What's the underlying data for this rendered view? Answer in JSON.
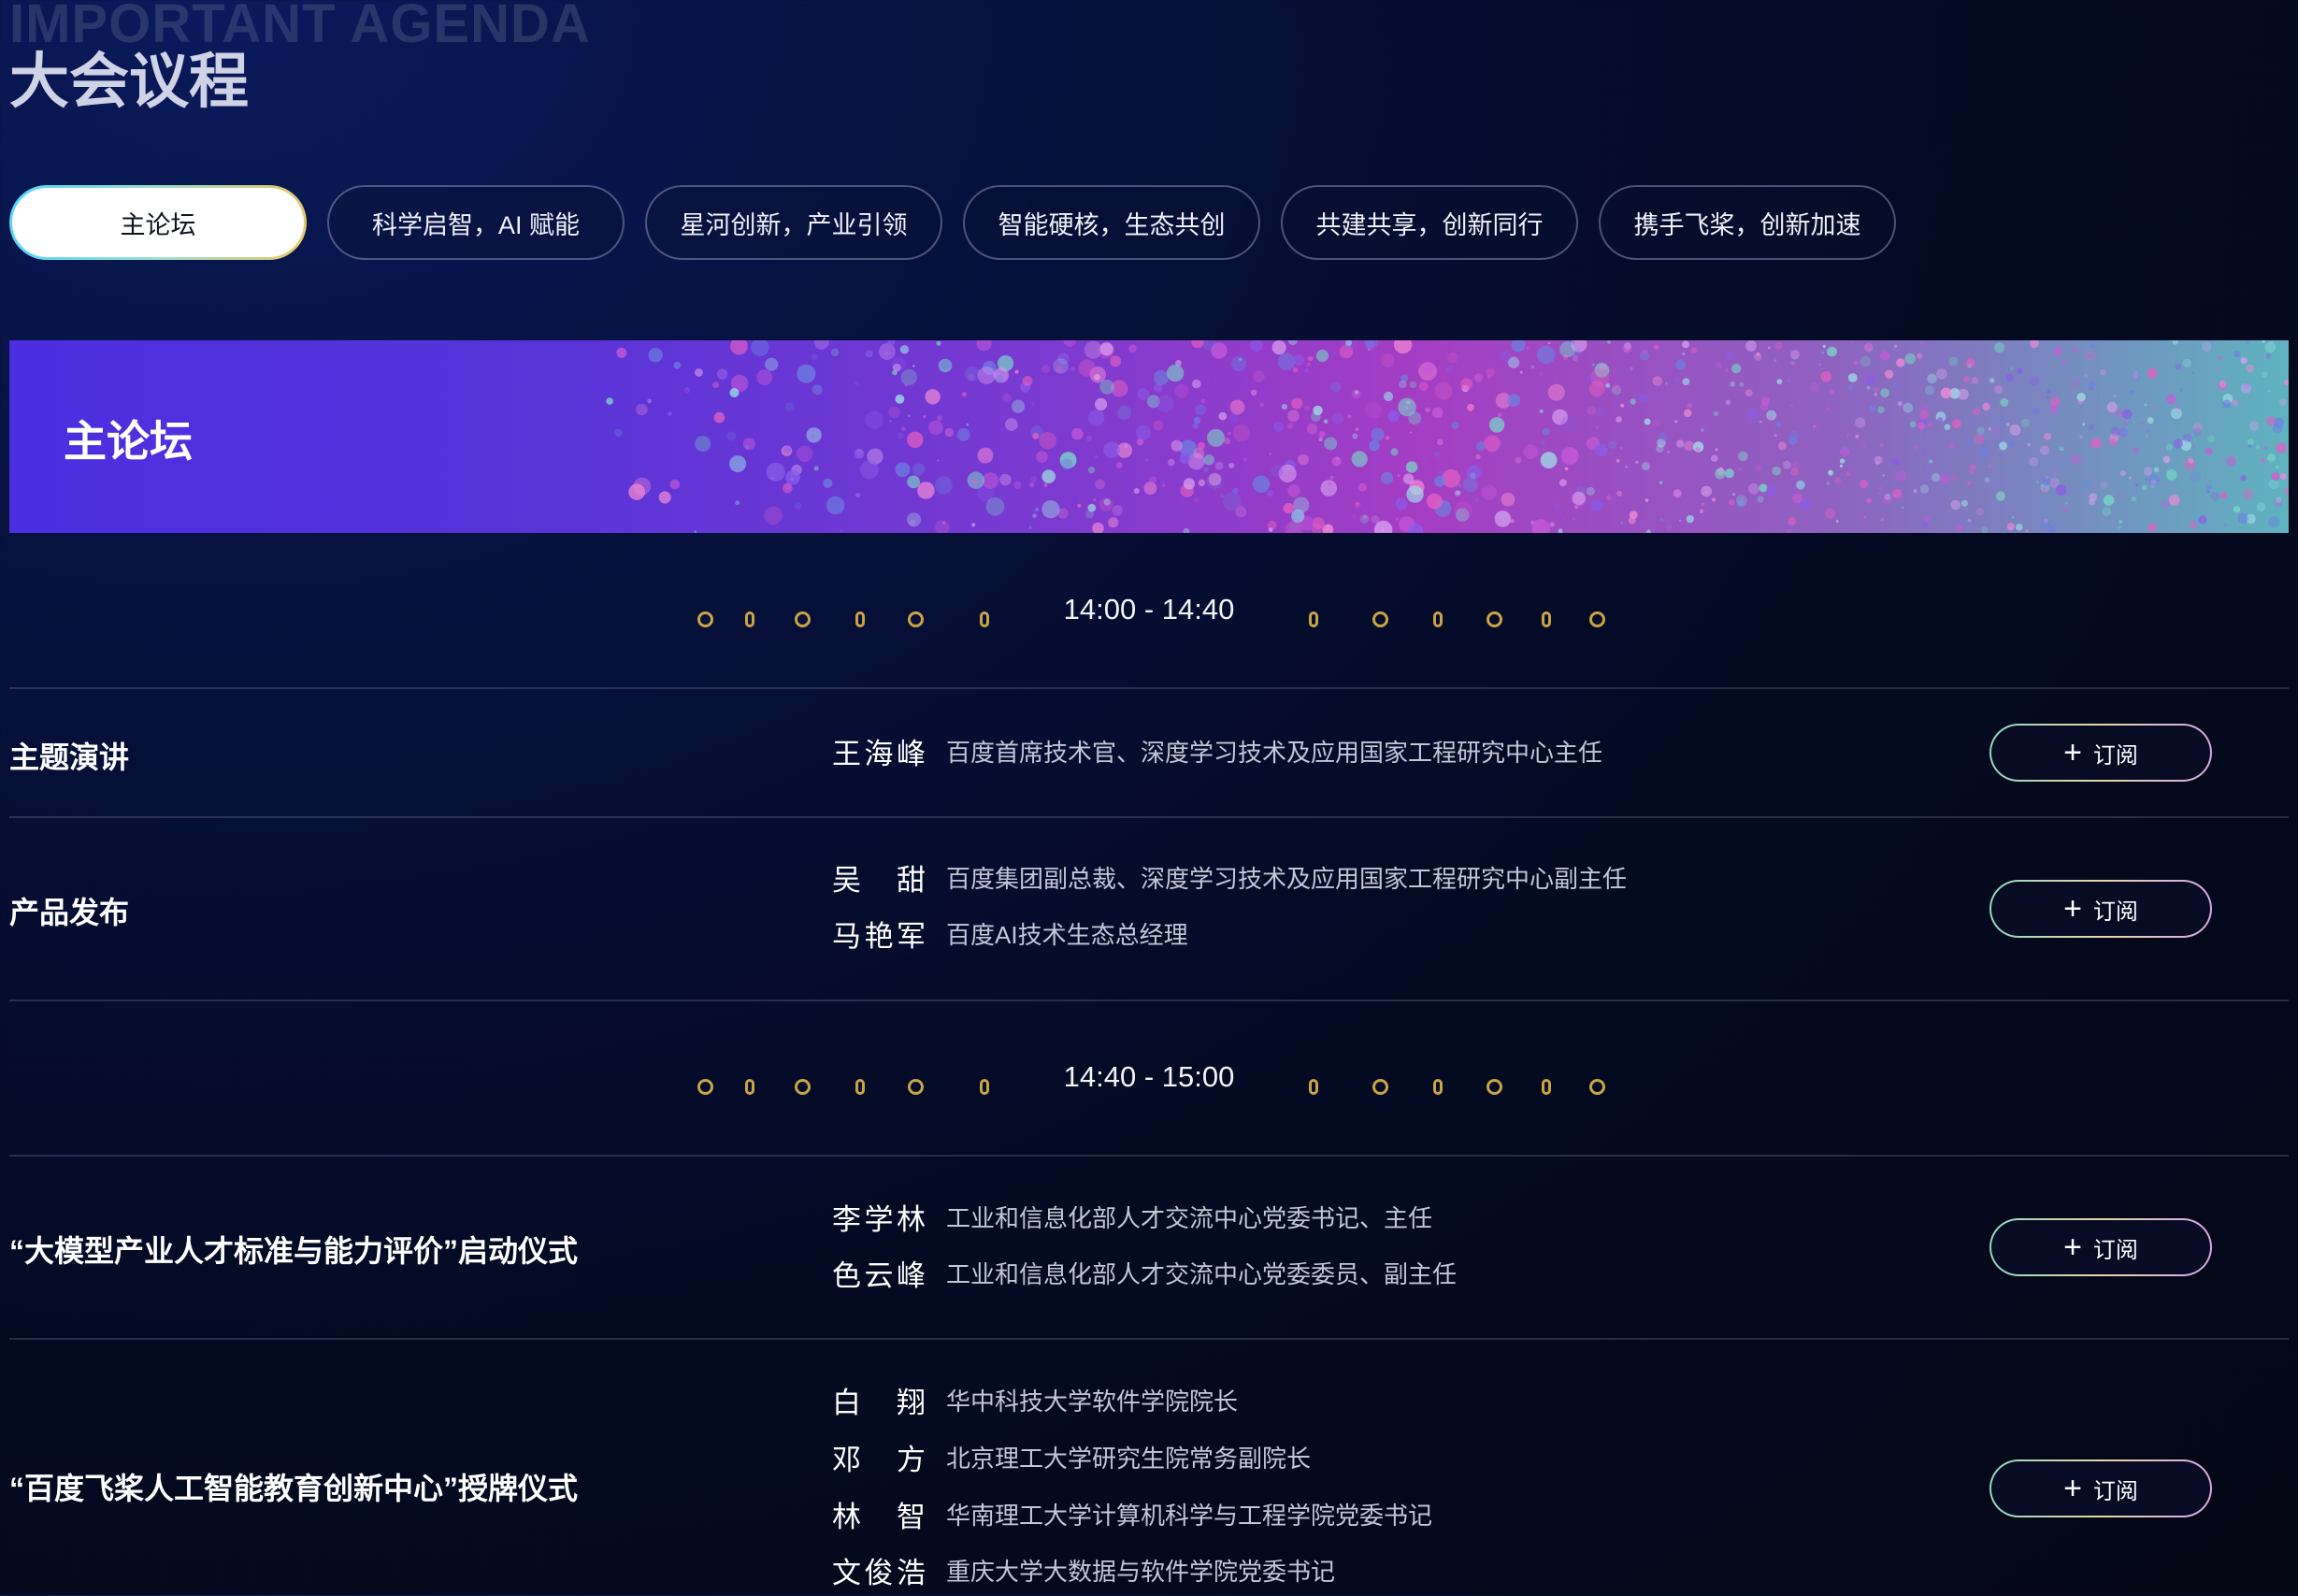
{
  "header": {
    "en_title": "IMPORTANT AGENDA",
    "zh_title": "大会议程"
  },
  "tabs": [
    {
      "label": "主论坛",
      "active": true
    },
    {
      "label": "科学启智，AI 赋能",
      "active": false
    },
    {
      "label": "星河创新，产业引领",
      "active": false
    },
    {
      "label": "智能硬核，生态共创",
      "active": false
    },
    {
      "label": "共建共享，创新同行",
      "active": false
    },
    {
      "label": "携手飞桨，创新加速",
      "active": false
    }
  ],
  "banner": {
    "title": "主论坛"
  },
  "subscribe_label": "订阅",
  "blocks": [
    {
      "time": "14:00 - 14:40",
      "sessions": [
        {
          "title": "主题演讲",
          "speakers": [
            {
              "name": "王海峰",
              "role": "百度首席技术官、深度学习技术及应用国家工程研究中心主任"
            }
          ]
        },
        {
          "title": "产品发布",
          "speakers": [
            {
              "name": "吴甜",
              "role": "百度集团副总裁、深度学习技术及应用国家工程研究中心副主任"
            },
            {
              "name": "马艳军",
              "role": "百度AI技术生态总经理"
            }
          ]
        }
      ]
    },
    {
      "time": "14:40 - 15:00",
      "sessions": [
        {
          "title": "“大模型产业人才标准与能力评价”启动仪式",
          "speakers": [
            {
              "name": "李学林",
              "role": "工业和信息化部人才交流中心党委书记、主任"
            },
            {
              "name": "色云峰",
              "role": "工业和信息化部人才交流中心党委委员、副主任"
            }
          ]
        },
        {
          "title": "“百度飞桨人工智能教育创新中心”授牌仪式",
          "speakers": [
            {
              "name": "白翔",
              "role": "华中科技大学软件学院院长"
            },
            {
              "name": "邓方",
              "role": "北京理工大学研究生院常务副院长"
            },
            {
              "name": "林智",
              "role": "华南理工大学计算机科学与工程学院党委书记"
            },
            {
              "name": "文俊浩",
              "role": "重庆大学大数据与软件学院党委书记"
            }
          ]
        }
      ]
    }
  ],
  "colors": {
    "accent_gold": "#c9a446",
    "banner_start": "#4a2ee0",
    "banner_end": "#5fb3c0"
  }
}
